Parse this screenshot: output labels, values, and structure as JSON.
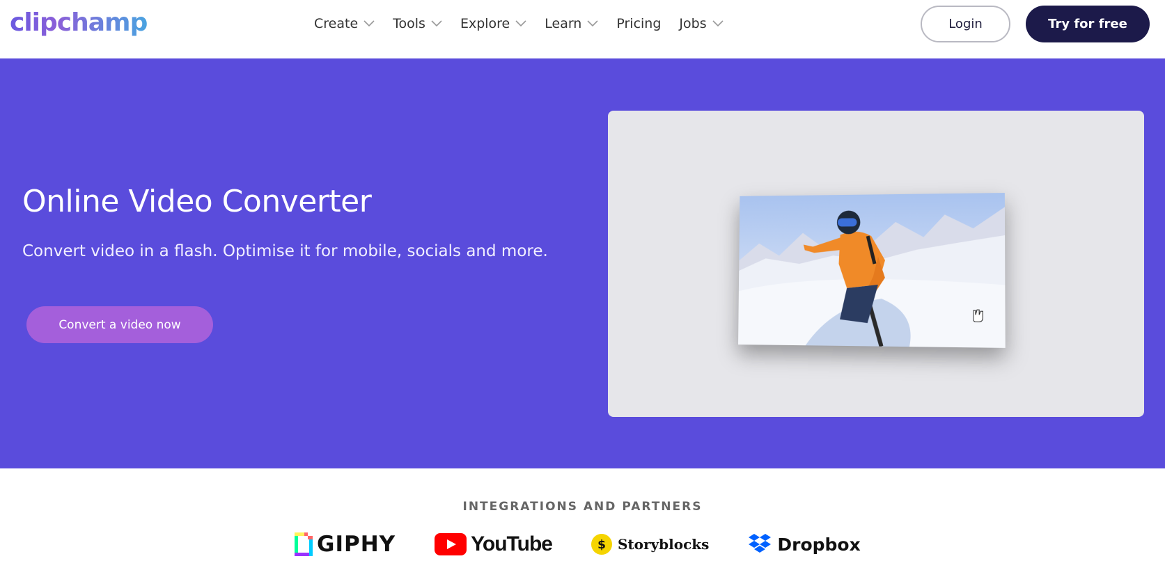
{
  "header": {
    "logo_text": "clipchamp",
    "nav": [
      {
        "label": "Create",
        "has_dropdown": true
      },
      {
        "label": "Tools",
        "has_dropdown": true
      },
      {
        "label": "Explore",
        "has_dropdown": true
      },
      {
        "label": "Learn",
        "has_dropdown": true
      },
      {
        "label": "Pricing",
        "has_dropdown": false
      },
      {
        "label": "Jobs",
        "has_dropdown": true
      }
    ],
    "login_label": "Login",
    "try_label": "Try for free"
  },
  "hero": {
    "title": "Online Video Converter",
    "subtitle": "Convert video in a flash. Optimise it for mobile, socials and more.",
    "cta_label": "Convert a video now",
    "background_color": "#5a4cdc"
  },
  "partners": {
    "heading": "INTEGRATIONS AND PARTNERS",
    "items": [
      {
        "name": "GIPHY",
        "icon": "giphy-icon"
      },
      {
        "name": "YouTube",
        "icon": "youtube-icon"
      },
      {
        "name": "Storyblocks",
        "icon": "storyblocks-icon"
      },
      {
        "name": "Dropbox",
        "icon": "dropbox-icon"
      }
    ]
  },
  "colors": {
    "brand_dark": "#1c1a4a",
    "cta_purple": "#a45fdb"
  }
}
